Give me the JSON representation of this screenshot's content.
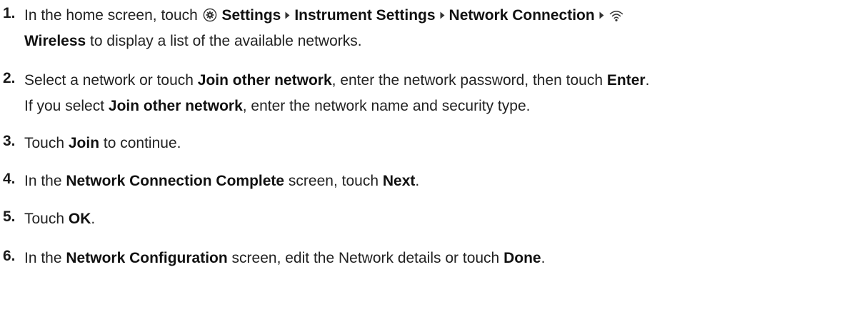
{
  "steps": [
    {
      "number": "1.",
      "line1": {
        "t1": "In the home screen, touch ",
        "settings": "Settings",
        "instrument_settings": "Instrument Settings",
        "network_connection": "Network Connection"
      },
      "line2": {
        "wireless": "Wireless",
        "t2": " to display a list of the available networks."
      }
    },
    {
      "number": "2.",
      "line1": {
        "t1": "Select a network or touch ",
        "b1": "Join other network",
        "t2": ", enter the network password, then touch ",
        "b2": "Enter",
        "t3": "."
      },
      "line2": {
        "t1": "If you select ",
        "b1": "Join other network",
        "t2": ", enter the network name and security type."
      }
    },
    {
      "number": "3.",
      "t1": "Touch ",
      "b1": "Join",
      "t2": " to continue."
    },
    {
      "number": "4.",
      "t1": "In the ",
      "b1": "Network Connection Complete",
      "t2": " screen, touch ",
      "b2": "Next",
      "t3": "."
    },
    {
      "number": "5.",
      "t1": "Touch ",
      "b1": "OK",
      "t2": "."
    },
    {
      "number": "6.",
      "t1": "In the ",
      "b1": "Network Configuration",
      "t2": " screen, edit the Network details or touch ",
      "b2": "Done",
      "t3": "."
    }
  ],
  "icons": {
    "settings": "gear-icon",
    "wireless": "wifi-icon",
    "separator": "caret-right-icon"
  }
}
